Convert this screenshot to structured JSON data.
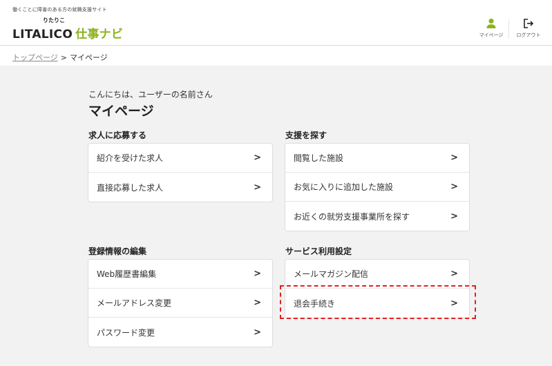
{
  "header": {
    "tagline": "働くことに障害のある方の就職支援サイト",
    "logo_ruby": "りたりこ",
    "logo_main": "LITALICO",
    "logo_sub": "仕事ナビ",
    "mypage_label": "マイページ",
    "logout_label": "ログアウト"
  },
  "breadcrumb": {
    "top_link": "トップページ",
    "separator": ">",
    "current": "マイページ"
  },
  "main": {
    "greeting": "こんにちは、ユーザーの名前さん",
    "title": "マイページ",
    "sections": {
      "apply": {
        "title": "求人に応募する",
        "items": [
          {
            "label": "紹介を受けた求人"
          },
          {
            "label": "直接応募した求人"
          }
        ]
      },
      "support": {
        "title": "支援を探す",
        "items": [
          {
            "label": "閲覧した施設"
          },
          {
            "label": "お気に入りに追加した施設"
          },
          {
            "label": "お近くの就労支援事業所を探す"
          }
        ]
      },
      "profile": {
        "title": "登録情報の編集",
        "items": [
          {
            "label": "Web履歴書編集"
          },
          {
            "label": "メールアドレス変更"
          },
          {
            "label": "パスワード変更"
          }
        ]
      },
      "service": {
        "title": "サービス利用設定",
        "items": [
          {
            "label": "メールマガジン配信"
          },
          {
            "label": "退会手続き"
          }
        ]
      }
    },
    "chevron": ">"
  },
  "colors": {
    "brand_green": "#8cb320",
    "highlight_red": "#e02020",
    "page_bg": "#f2f2f2"
  },
  "icons": {
    "mypage": "user-icon",
    "logout": "logout-icon",
    "chevron": "chevron-right-icon"
  }
}
